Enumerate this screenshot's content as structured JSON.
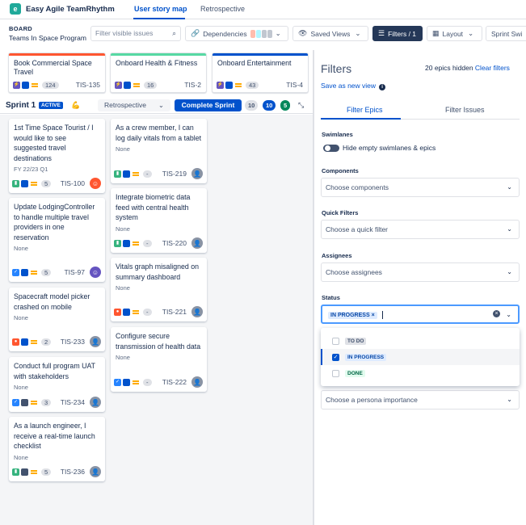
{
  "app": {
    "name": "Easy Agile TeamRhythm",
    "logo_letter": "e"
  },
  "tabs": [
    {
      "label": "User story map",
      "active": true
    },
    {
      "label": "Retrospective",
      "active": false
    }
  ],
  "board": {
    "label": "BOARD",
    "name": "Teams In Space Program"
  },
  "toolbar": {
    "search_placeholder": "Filter visible issues",
    "dependencies": "Dependencies",
    "saved_views": "Saved Views",
    "filters": "Filters / 1",
    "layout": "Layout",
    "sprint_switch": "Sprint Swi"
  },
  "epics": [
    {
      "title": "Book Commercial Space Travel",
      "count": "124",
      "key": "TIS-135",
      "color": "#ff5630"
    },
    {
      "title": "Onboard Health & Fitness",
      "count": "16",
      "key": "TIS-2",
      "color": "#57d9a3"
    },
    {
      "title": "Onboard Entertainment",
      "count": "43",
      "key": "TIS-4",
      "color": "#0052cc"
    }
  ],
  "sprint": {
    "name": "Sprint 1",
    "status": "ACTIVE",
    "goal_icon": "💪",
    "retro_select": "Retrospective",
    "complete_button": "Complete Sprint",
    "counts": [
      "10",
      "10",
      "5"
    ]
  },
  "cards_col1": [
    {
      "title": "1st Time Space Tourist / I would like to see suggested travel destinations",
      "meta": "FY 22/23 Q1",
      "points": "5",
      "key": "TIS-100"
    },
    {
      "title": "Update LodgingController to handle multiple travel providers in one reservation",
      "meta": "None",
      "points": "5",
      "key": "TIS-97"
    },
    {
      "title": "Spacecraft model picker crashed on mobile",
      "meta": "None",
      "points": "2",
      "key": "TIS-233"
    },
    {
      "title": "Conduct full program UAT with stakeholders",
      "meta": "None",
      "points": "3",
      "key": "TIS-234"
    },
    {
      "title": "As a launch engineer, I receive a real-time launch checklist",
      "meta": "None",
      "points": "5",
      "key": "TIS-236"
    }
  ],
  "cards_col2": [
    {
      "title": "As a crew member, I can log daily vitals from a tablet",
      "meta": "None",
      "points": "-",
      "key": "TIS-219"
    },
    {
      "title": "Integrate biometric data feed with central health system",
      "meta": "None",
      "points": "-",
      "key": "TIS-220"
    },
    {
      "title": "Vitals graph misaligned on summary dashboard",
      "meta": "None",
      "points": "-",
      "key": "TIS-221"
    },
    {
      "title": "Configure secure transmission of health data",
      "meta": "None",
      "points": "-",
      "key": "TIS-222"
    }
  ],
  "filters": {
    "title": "Filters",
    "hidden_text": "20 epics hidden",
    "clear_label": "Clear filters",
    "save_view": "Save as new view",
    "tab_epics": "Filter Epics",
    "tab_issues": "Filter Issues",
    "swimlanes_label": "Swimlanes",
    "swimlanes_toggle": "Hide empty swimlanes & epics",
    "components_label": "Components",
    "components_placeholder": "Choose components",
    "quick_label": "Quick Filters",
    "quick_placeholder": "Choose a quick filter",
    "assignees_label": "Assignees",
    "assignees_placeholder": "Choose assignees",
    "status_label": "Status",
    "status_value": "IN PROGRESS",
    "persona_placeholder": "Choose a persona importance",
    "status_options": [
      {
        "label": "TO DO",
        "checked": false
      },
      {
        "label": "IN PROGRESS",
        "checked": true
      },
      {
        "label": "DONE",
        "checked": false
      }
    ]
  }
}
